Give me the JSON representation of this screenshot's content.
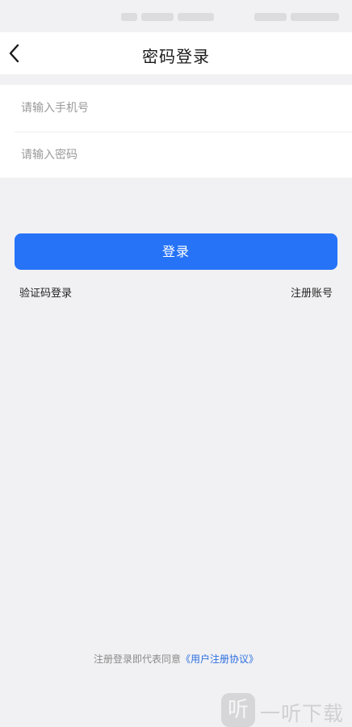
{
  "header": {
    "title": "密码登录",
    "back_icon": "chevron-left-icon"
  },
  "form": {
    "phone_placeholder": "请输入手机号",
    "password_placeholder": "请输入密码"
  },
  "actions": {
    "login_label": "登录",
    "sms_login_label": "验证码登录",
    "register_label": "注册账号"
  },
  "agreement": {
    "prefix": "注册登录即代表同意",
    "link": "《用户注册协议》"
  },
  "watermark": {
    "logo_glyph": "听",
    "text": "一听下载"
  },
  "colors": {
    "primary": "#2673f8",
    "link": "#2d6fe0",
    "background": "#f1f1f3"
  }
}
